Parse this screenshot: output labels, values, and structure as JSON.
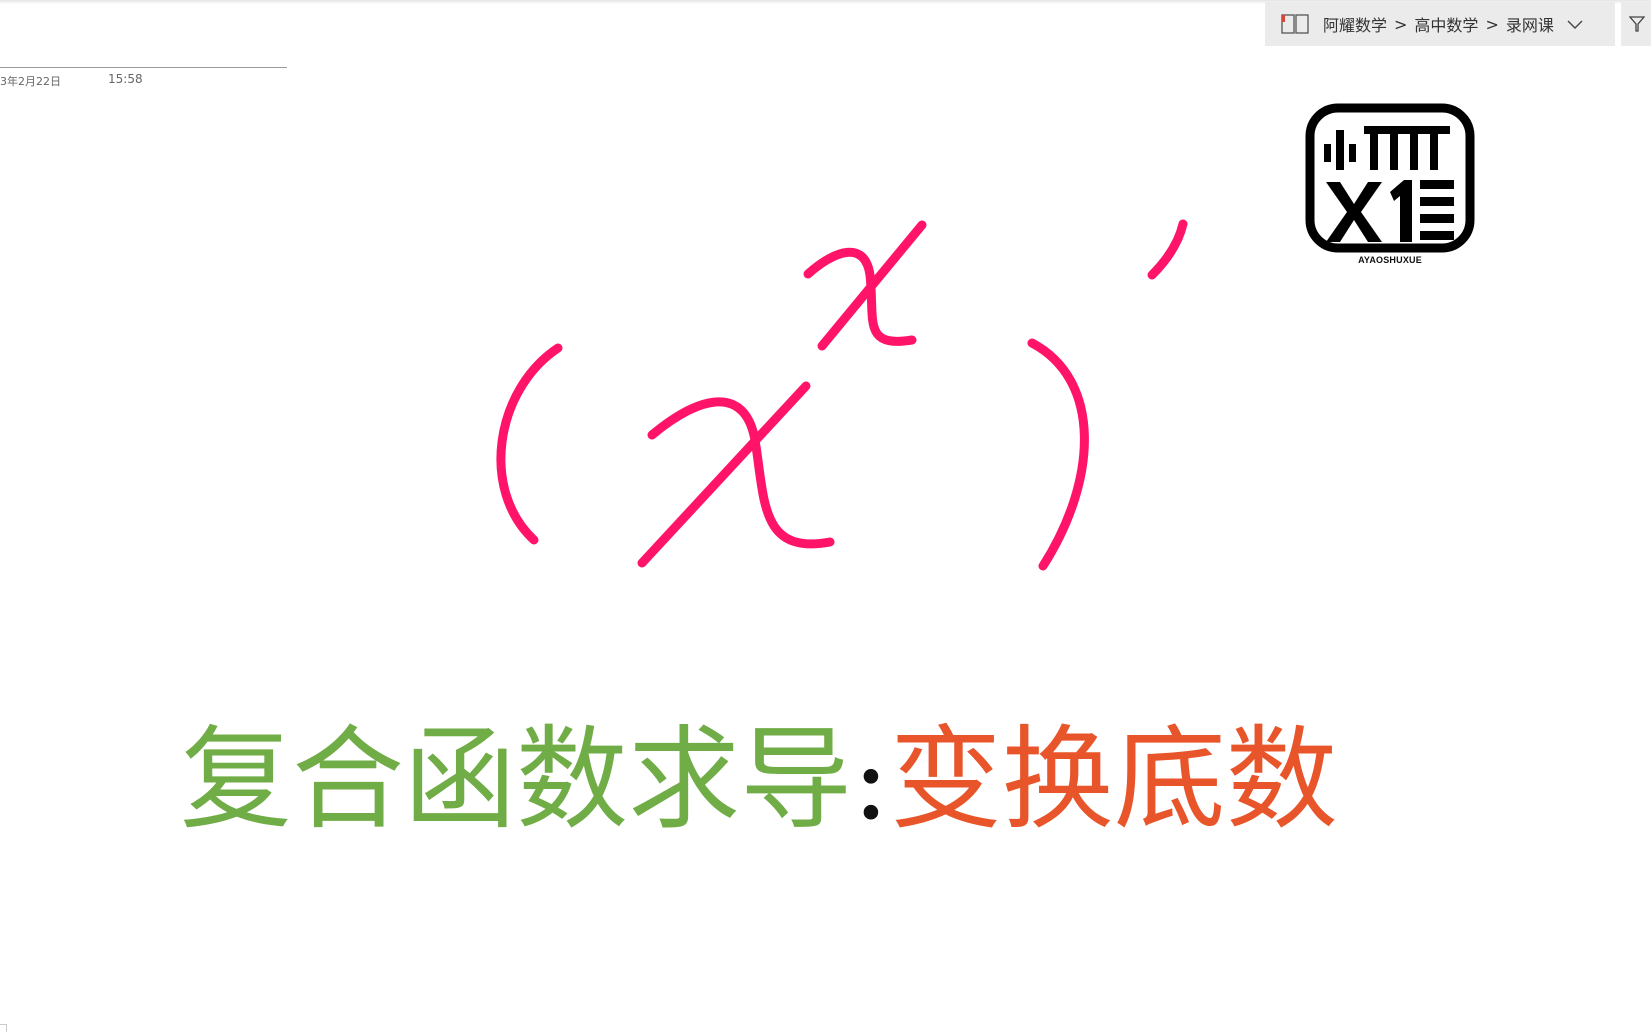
{
  "breadcrumb": {
    "items": [
      "阿耀数学",
      "高中数学",
      "录网课"
    ],
    "separator": ">",
    "icon": "notebook-icon",
    "expand_icon": "chevron-down-icon"
  },
  "filter_icon": "filter-icon",
  "page_meta": {
    "date": "3年2月22日",
    "time": "15:58"
  },
  "logo": {
    "caption": "AYAOSHUXUE"
  },
  "formula": {
    "latex": "(x^x)'",
    "ink_color": "#ff1469"
  },
  "headline": {
    "part1": "复合函数求导",
    "colon": ":",
    "part2": "变换底数",
    "part1_color": "#70ad47",
    "part2_color": "#e8552a"
  }
}
